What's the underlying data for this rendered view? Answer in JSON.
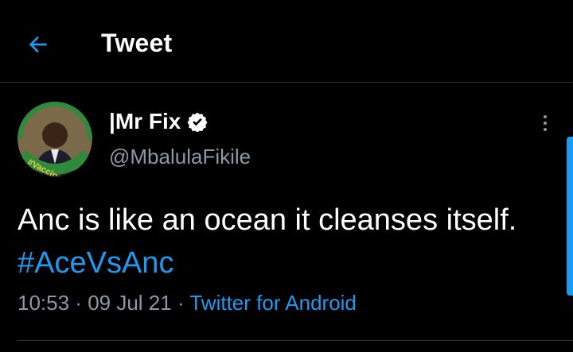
{
  "header": {
    "title": "Tweet",
    "back_icon": "back-arrow-icon"
  },
  "author": {
    "display_name": "|Mr Fix",
    "handle": "@MbalulaFikile",
    "verified_icon": "verified-badge-icon",
    "avatar_badge_text": "#Vaccinate"
  },
  "tweet": {
    "text": "Anc is like an ocean it cleanses itself.",
    "hashtag": "#AceVsAnc"
  },
  "meta": {
    "time": "10:53",
    "separator": " · ",
    "date": "09 Jul 21",
    "source": "Twitter for Android"
  },
  "colors": {
    "background": "#000000",
    "accent": "#1d9bf0",
    "secondary_text": "#8b98a5"
  }
}
